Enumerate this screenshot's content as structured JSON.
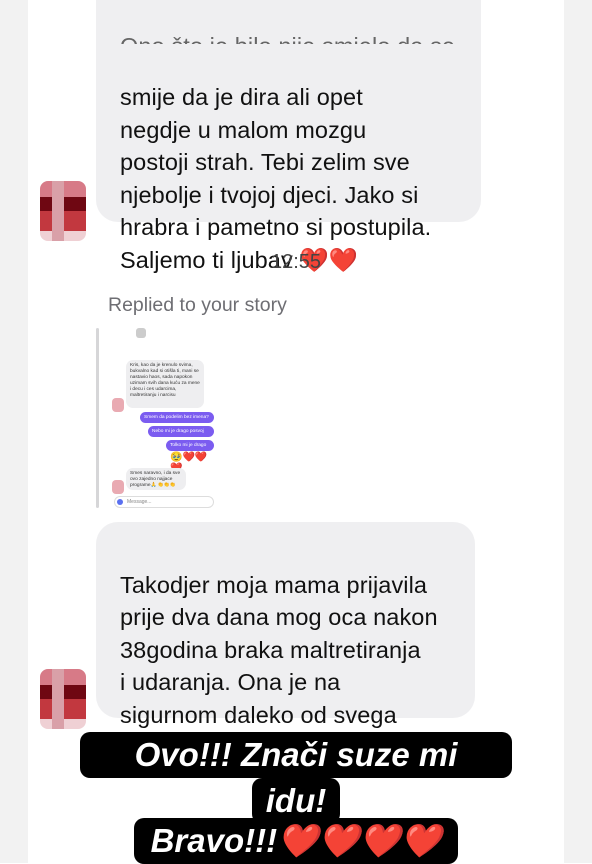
{
  "messages": {
    "first": {
      "clipped_line": "Ono što je bilo nije smjelo da se desi",
      "text": "smije da je dira ali opet\nnegdje u malom mozgu\npostoji strah. Tebi zelim sve\nnjebolje i tvojoj djeci. Jako si\nhrabra i pametno si postupila.\nSaljemo ti ljubav ❤️❤️"
    },
    "timestamp": "12:55",
    "reply_label": "Replied to your story",
    "second": {
      "text": "Takodjer moja mama prijavila\nprije dva dana mog oca nakon\n38godina braka maltretiranja\ni udaranja. Ona je na\nsigurnom daleko od svega\nkod mene a on je priveden❤️"
    }
  },
  "story_preview": {
    "msg1": "Kris, kao da je krenulo svima, bukvalno kad si otišla ti, mani se nastavio haos, sada napokon uzimam svih dana kuću za mene i decu i ces udarcima, maltretiranju i narcisu",
    "purple1": "Smem da podelim bez imena?",
    "purple2": "Nebo mi je drago posvoj",
    "purple3": "Tolko mi je drago",
    "hearts": "🥹❤️❤️❤️",
    "msg2": "Smes naravno, i da sve ovo zajedno najjace programe🙏 👏👏👏",
    "input_placeholder": "Message..."
  },
  "caption": {
    "line1": "Ovo!!! Znači suze mi",
    "line2": "idu!",
    "line3": "Bravo!!!❤️❤️❤️❤️"
  },
  "colors": {
    "bubble": "#efeff1",
    "caption_bg": "#000000",
    "heart": "#e0202e",
    "accent_purple": "#7b5cf0"
  }
}
